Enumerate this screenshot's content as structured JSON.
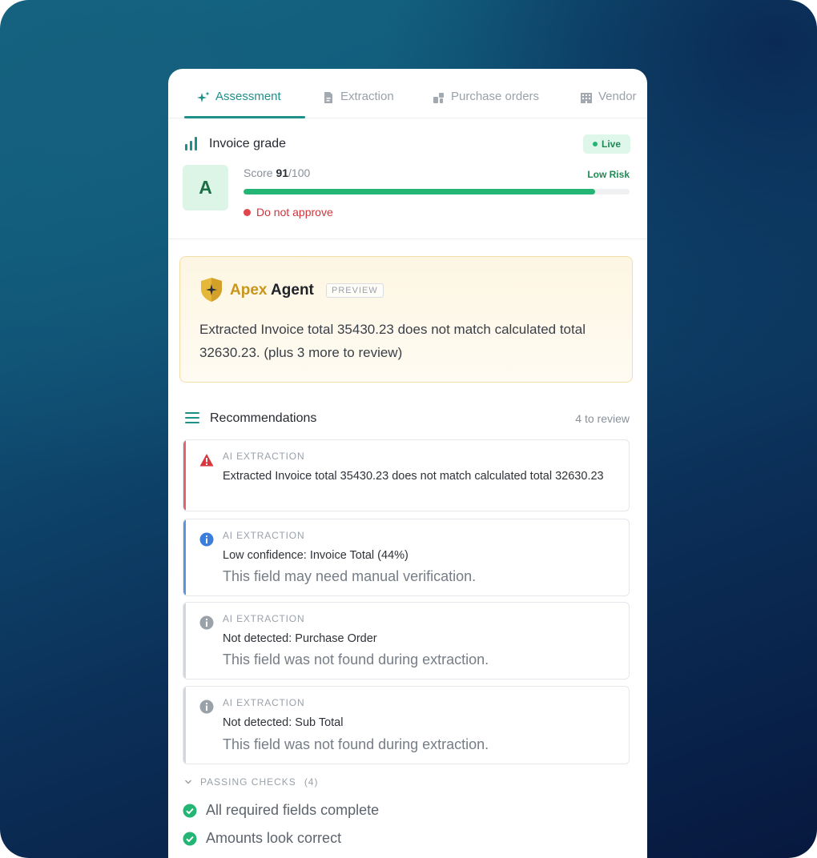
{
  "tabs": [
    {
      "label": "Assessment",
      "icon": "sparkle-icon",
      "active": true
    },
    {
      "label": "Extraction",
      "icon": "document-icon",
      "active": false
    },
    {
      "label": "Purchase orders",
      "icon": "boxes-icon",
      "active": false
    },
    {
      "label": "Vendor",
      "icon": "building-icon",
      "active": false
    }
  ],
  "grade": {
    "title": "Invoice grade",
    "status_badge": "Live",
    "letter": "A",
    "score_label": "Score",
    "score_value": "91",
    "score_max": "/100",
    "progress_fraction": 0.91,
    "risk_label": "Low Risk",
    "approval_status": "Do not approve"
  },
  "agent": {
    "brand": "Apex",
    "word": "Agent",
    "badge": "PREVIEW",
    "message": "Extracted Invoice total 35430.23 does not match calculated total 32630.23. (plus 3 more to review)"
  },
  "recommendations": {
    "title": "Recommendations",
    "count": "4 to review",
    "items": [
      {
        "severity": "error",
        "category": "AI EXTRACTION",
        "message": "Extracted Invoice total 35430.23 does not match calculated total 32630.23",
        "detail": ""
      },
      {
        "severity": "info",
        "category": "AI EXTRACTION",
        "message": "Low confidence: Invoice Total (44%)",
        "detail": "This field may need manual verification."
      },
      {
        "severity": "neutral",
        "category": "AI EXTRACTION",
        "message": "Not detected: Purchase Order",
        "detail": "This field was not found during extraction."
      },
      {
        "severity": "neutral",
        "category": "AI EXTRACTION",
        "message": "Not detected: Sub Total",
        "detail": "This field was not found during extraction."
      }
    ]
  },
  "passing": {
    "title": "PASSING CHECKS",
    "count": "(4)",
    "items": [
      "All required fields complete",
      "Amounts look correct"
    ]
  },
  "colors": {
    "accent": "#1f8f8a",
    "success": "#22b573",
    "danger": "#e0464c",
    "info": "#3b7ddd",
    "agent_gold": "#c99619"
  }
}
